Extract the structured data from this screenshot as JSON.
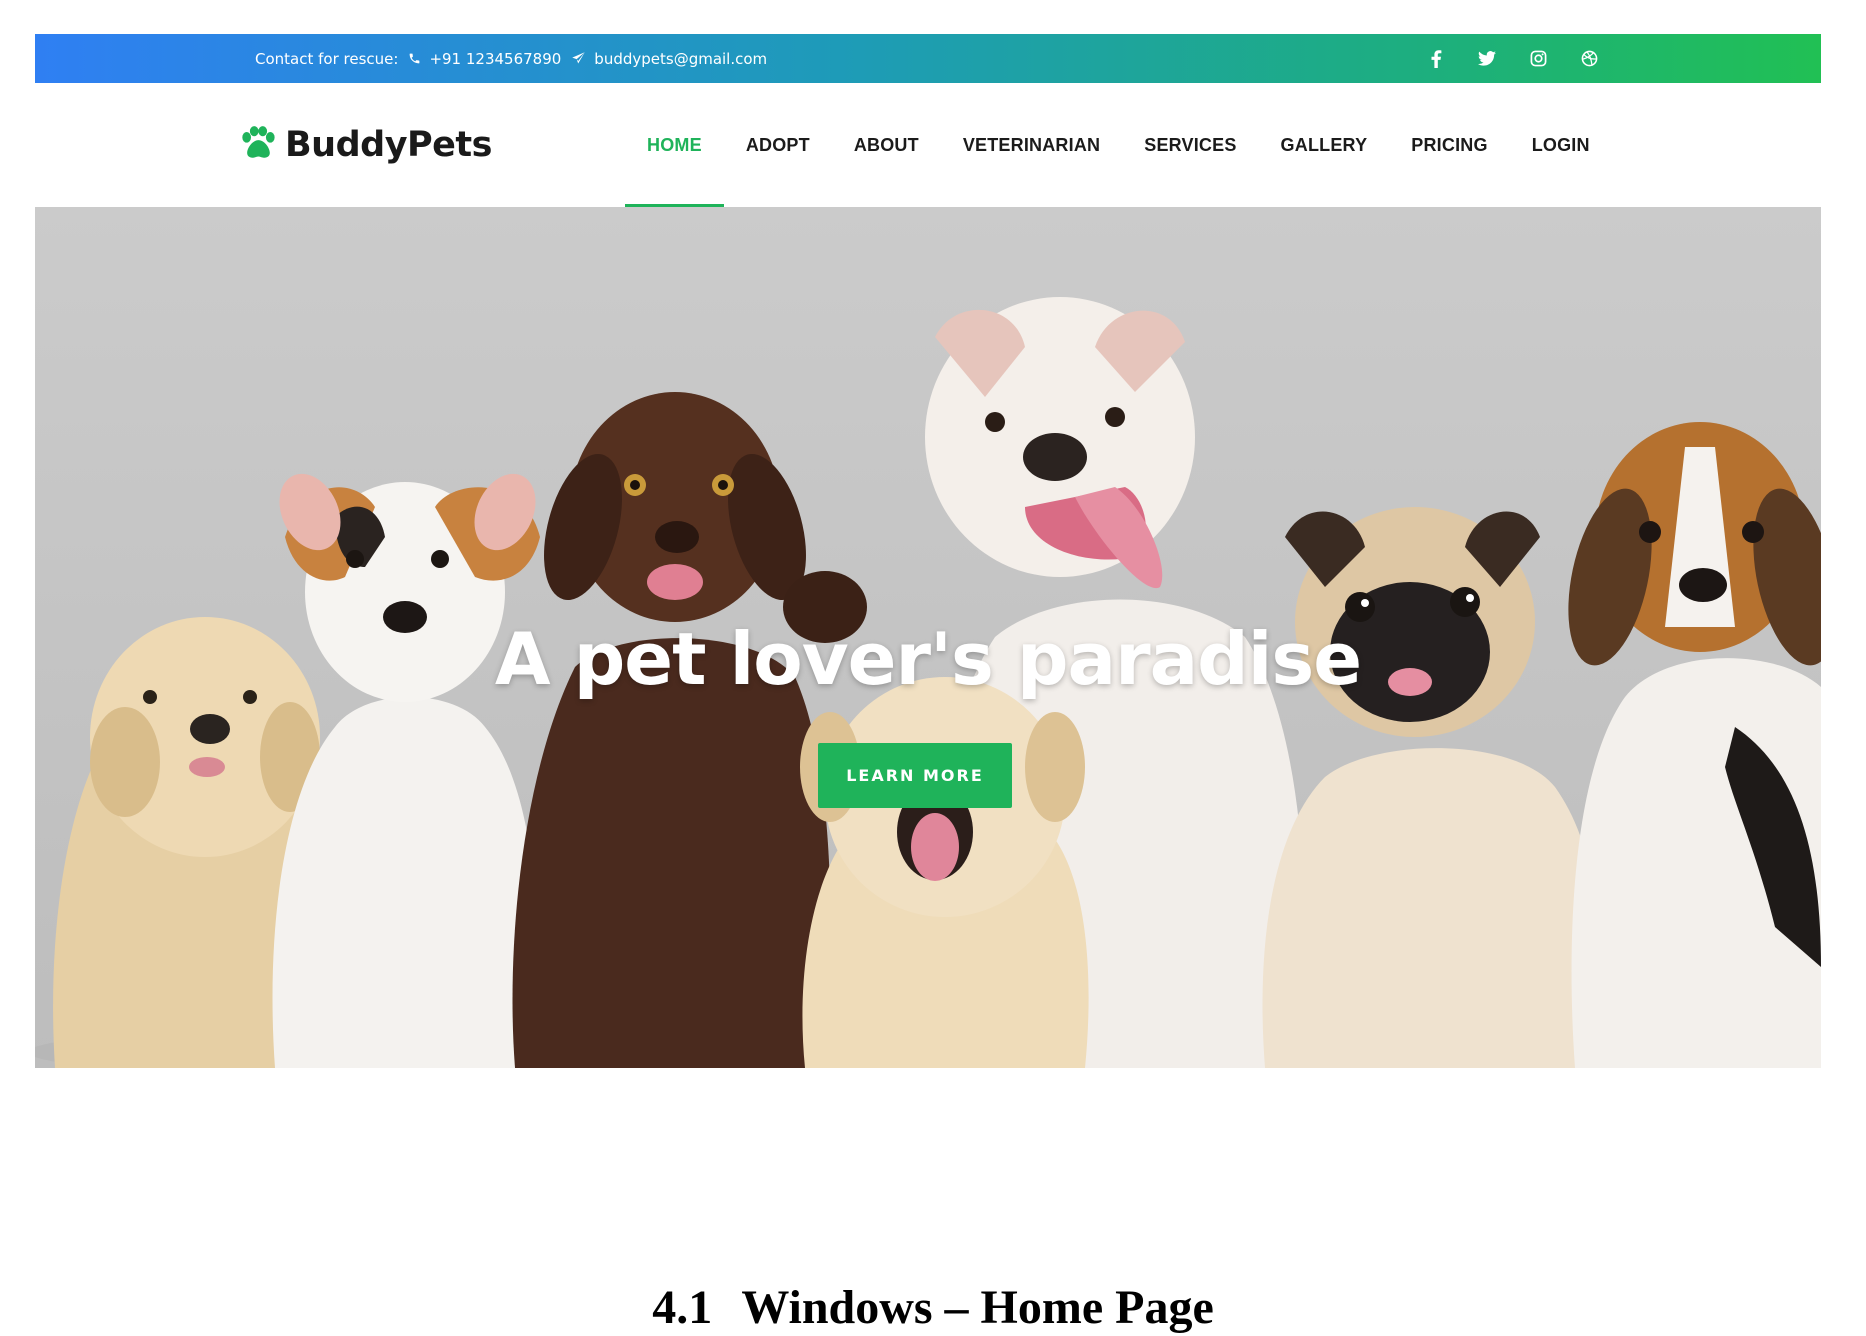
{
  "topbar": {
    "contact_label": "Contact for rescue:",
    "phone": "+91 1234567890",
    "email": "buddypets@gmail.com",
    "phone_icon": "phone-icon",
    "email_icon": "paper-plane-icon",
    "social_icons": [
      "facebook-icon",
      "twitter-icon",
      "instagram-icon",
      "dribbble-icon"
    ],
    "gradient": [
      "#2f7ff3",
      "#21c054"
    ]
  },
  "nav": {
    "logo_icon": "paw-icon",
    "brand": "BuddyPets",
    "items": [
      {
        "label": "HOME",
        "active": true
      },
      {
        "label": "ADOPT",
        "active": false
      },
      {
        "label": "ABOUT",
        "active": false
      },
      {
        "label": "VETERINARIAN",
        "active": false
      },
      {
        "label": "SERVICES",
        "active": false
      },
      {
        "label": "GALLERY",
        "active": false
      },
      {
        "label": "PRICING",
        "active": false
      },
      {
        "label": "LOGIN",
        "active": false
      }
    ],
    "accent_color": "#1fb35a"
  },
  "hero": {
    "headline": "A pet lover's paradise",
    "cta_label": "LEARN MORE",
    "image": "group of puppies and dogs sitting"
  },
  "caption": {
    "number": "4.1",
    "text": "Windows – Home Page"
  }
}
